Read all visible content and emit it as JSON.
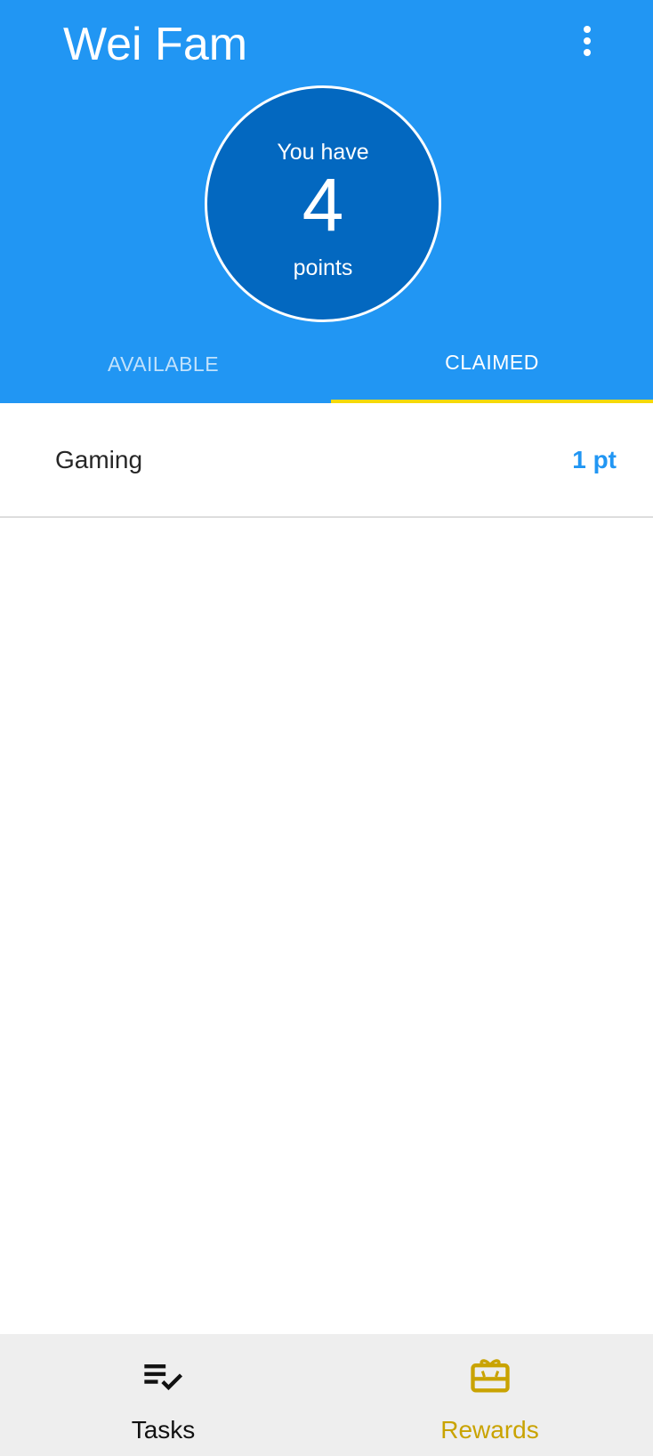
{
  "app": {
    "title": "Wei Fam"
  },
  "points": {
    "prefix": "You have",
    "value": "4",
    "suffix": "points"
  },
  "tabs": [
    {
      "label": "AVAILABLE",
      "active": false
    },
    {
      "label": "CLAIMED",
      "active": true
    }
  ],
  "rewards": [
    {
      "name": "Gaming",
      "points": "1 pt"
    }
  ],
  "bottom_nav": {
    "tasks": {
      "label": "Tasks",
      "icon": "playlist-check-icon",
      "active": false
    },
    "rewards": {
      "label": "Rewards",
      "icon": "gift-card-icon",
      "active": true
    }
  },
  "colors": {
    "primary": "#2196f3",
    "circle": "#0368c0",
    "tab_indicator": "#f5d90a",
    "active_nav": "#c9a300",
    "nav_background": "#eeeeee"
  }
}
